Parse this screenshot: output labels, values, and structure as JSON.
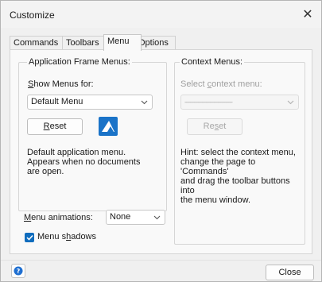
{
  "window": {
    "title": "Customize",
    "close_glyph": "✕"
  },
  "tabs": [
    {
      "label": "Commands",
      "active": false
    },
    {
      "label": "Toolbars",
      "active": false
    },
    {
      "label": "Menu",
      "active": true
    },
    {
      "label": "Options",
      "active": false
    }
  ],
  "app_frame": {
    "group_title": "Application Frame Menus:",
    "show_menus_for_prefix": "S",
    "show_menus_for_rest": "how Menus for:",
    "show_menus_for_value": "Default Menu",
    "reset_prefix": "R",
    "reset_rest": "eset",
    "description_lines": [
      "Default application menu.",
      "Appears when no documents",
      "are open."
    ],
    "icon": "app-logo-icon"
  },
  "context": {
    "group_title": "Context Menus:",
    "select_label_a": "Select ",
    "select_label_u": "c",
    "select_label_b": "ontext menu:",
    "select_value": "------------------------------------",
    "reset_prefix": "Re",
    "reset_u": "s",
    "reset_rest": "et",
    "hint_lines": [
      "Hint: select the context menu,",
      "change the page to 'Commands'",
      "and drag the toolbar buttons into",
      "the menu window."
    ]
  },
  "menu_animations": {
    "label_u": "M",
    "label_rest": "enu animations:",
    "value": "None"
  },
  "menu_shadows": {
    "label_a": "Menu s",
    "label_u": "h",
    "label_b": "adows",
    "checked": true
  },
  "footer": {
    "close_label": "Close",
    "help_icon": "help-icon"
  },
  "colors": {
    "accent": "#0f6cbd",
    "logo_blue": "#1a73c8"
  }
}
